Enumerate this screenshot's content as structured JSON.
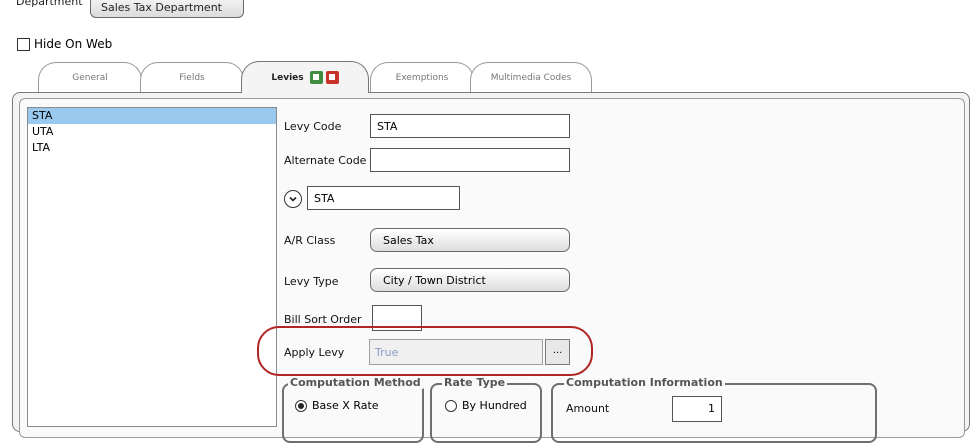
{
  "department": {
    "label": "Department",
    "value": "Sales Tax Department"
  },
  "hide_on_web": {
    "label": "Hide On Web",
    "checked": false
  },
  "tabs": [
    {
      "label": "General",
      "active": false
    },
    {
      "label": "Fields",
      "active": false
    },
    {
      "label": "Levies",
      "active": true
    },
    {
      "label": "Exemptions",
      "active": false
    },
    {
      "label": "Multimedia Codes",
      "active": false
    }
  ],
  "levies_tab_icons": [
    "add-levy-icon",
    "remove-levy-icon"
  ],
  "levy_list": [
    {
      "code": "STA",
      "selected": true
    },
    {
      "code": "UTA",
      "selected": false
    },
    {
      "code": "LTA",
      "selected": false
    }
  ],
  "form": {
    "levy_code": {
      "label": "Levy Code",
      "value": "STA"
    },
    "alternate_code": {
      "label": "Alternate Code",
      "value": ""
    },
    "expand_value": "STA",
    "ar_class": {
      "label": "A/R Class",
      "value": "Sales Tax"
    },
    "levy_type": {
      "label": "Levy Type",
      "value": "City / Town District"
    },
    "bill_sort_order": {
      "label": "Bill Sort Order",
      "value": ""
    },
    "apply_levy": {
      "label": "Apply Levy",
      "value": "True",
      "button": "..."
    }
  },
  "computation_method": {
    "title": "Computation Method",
    "option": "Base X Rate",
    "selected": true
  },
  "rate_type": {
    "title": "Rate Type",
    "option": "By Hundred",
    "selected": false
  },
  "computation_information": {
    "title": "Computation Information",
    "amount_label": "Amount",
    "amount_value": "1"
  },
  "colors": {
    "selection": "#99c9ef",
    "highlight_ring": "#b02525",
    "disabled_text": "#8c9cc8"
  }
}
